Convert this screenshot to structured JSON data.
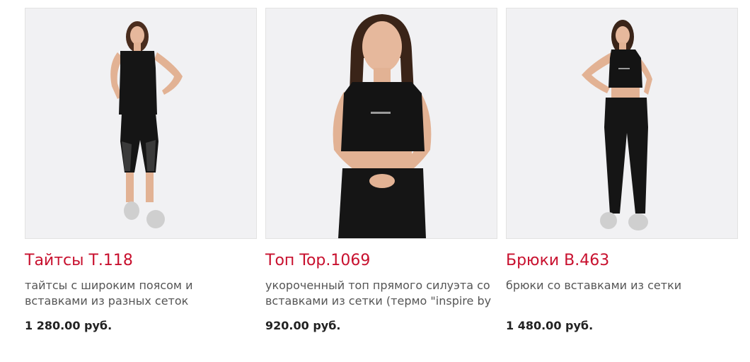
{
  "products": [
    {
      "name": "Тайтсы Т.118",
      "description": "тайтсы с широким поясом и вставками из разных сеток",
      "price": "1 280.00 руб."
    },
    {
      "name": "Топ Top.1069",
      "description": "укороченный топ прямого силуэта со вставками из сетки (термо \"inspire by",
      "price": "920.00 руб."
    },
    {
      "name": "Брюки B.463",
      "description": "брюки со вставками из сетки",
      "price": "1 480.00 руб."
    }
  ],
  "colors": {
    "title": "#c8102e",
    "description": "#555555",
    "price": "#222222",
    "photo_background": "#f1f1f3"
  }
}
